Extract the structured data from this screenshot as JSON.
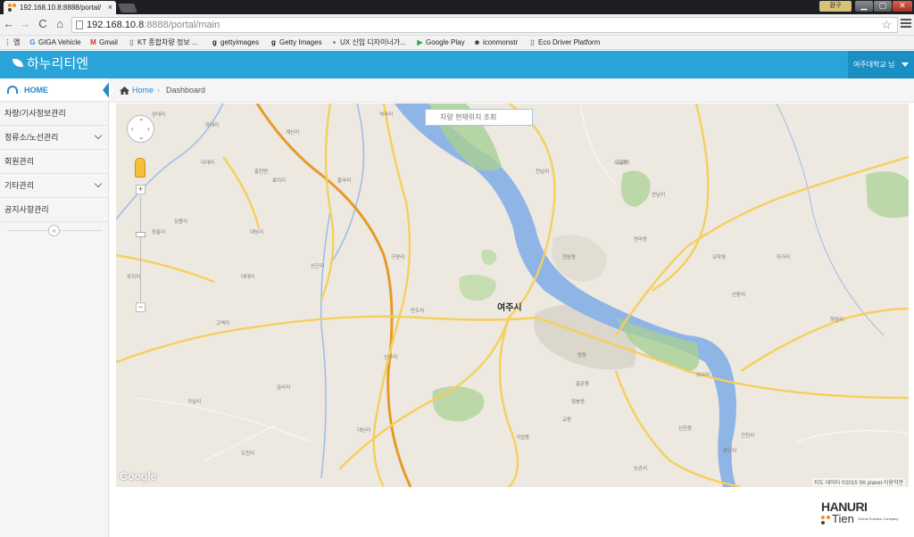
{
  "browser": {
    "tab_title": "192.168.10.8:8888/portal/",
    "close_glyph": "×",
    "url_host": "192.168.10.8",
    "url_path": ":8888/portal/main",
    "user_badge": "환구",
    "win_min": "▁",
    "win_max": "▢",
    "win_close": "✕",
    "nav": {
      "back": "←",
      "forward": "→",
      "reload": "C",
      "home": "⌂"
    },
    "star": "☆",
    "bookmarks": [
      {
        "label": "앱",
        "icon": "apps-icon",
        "glyph": "⋮"
      },
      {
        "label": "GIGA Vehicle",
        "icon": "google-icon",
        "glyph": "G"
      },
      {
        "label": "Gmail",
        "icon": "gmail-icon",
        "glyph": "M"
      },
      {
        "label": "KT 종합차량 정보 ...",
        "icon": "page-icon",
        "glyph": "▯"
      },
      {
        "label": "gettyimages",
        "icon": "getty-icon",
        "glyph": "g"
      },
      {
        "label": "Getty Images",
        "icon": "getty-icon",
        "glyph": "g"
      },
      {
        "label": "UX 신입 디자이너가...",
        "icon": "ux-icon",
        "glyph": "▪"
      },
      {
        "label": "Google Play",
        "icon": "play-icon",
        "glyph": "▶"
      },
      {
        "label": "iconmonstr",
        "icon": "iconmonstr-icon",
        "glyph": "☻"
      },
      {
        "label": "Eco Driver Platform",
        "icon": "page-icon",
        "glyph": "▯"
      }
    ]
  },
  "app": {
    "logo": "하누리티엔",
    "user_menu": "여주대학교 님",
    "colors": {
      "header": "#2aa3d8",
      "accent": "#2a86c7"
    }
  },
  "sidebar": {
    "home": "HOME",
    "items": [
      {
        "label": "차량/기사정보관리",
        "has_sub": false
      },
      {
        "label": "정류소/노선관리",
        "has_sub": true
      },
      {
        "label": "회원관리",
        "has_sub": false
      },
      {
        "label": "기타관리",
        "has_sub": true
      },
      {
        "label": "공지사항관리",
        "has_sub": false
      }
    ],
    "collapse": "«"
  },
  "breadcrumb": {
    "home": "Home",
    "sep": "›",
    "current": "Dashboard"
  },
  "map": {
    "search_placeholder": "차량 현재위치 조회",
    "city": "여주시",
    "google": "Google",
    "attribution": "지도 데이터 ©2015 SK planet   이용약관",
    "zoom_in": "+",
    "zoom_out": "−",
    "pan": {
      "up": "⌃",
      "down": "⌄",
      "left": "‹",
      "right": "›"
    },
    "places": [
      "상대리",
      "하대리",
      "흥천면",
      "다대리",
      "계신리",
      "효지리",
      "울국리",
      "대당리",
      "상용리",
      "대대리",
      "무지리",
      "장흥리",
      "고백리",
      "신근리",
      "구양리",
      "석곡리",
      "반도리",
      "신가리",
      "고교리",
      "금사리",
      "건천리",
      "외사리",
      "옹단리",
      "산남리",
      "현암동",
      "연라동",
      "오학동",
      "오금동",
      "하거리",
      "가업동",
      "능촌리",
      "천남리",
      "신진동",
      "점봉동",
      "홍문동",
      "교동",
      "창동",
      "가남리",
      "도천리",
      "대신리",
      "선동리",
      "하림리"
    ]
  },
  "footer": {
    "brand1": "HANURI",
    "brand2": "Tien",
    "tagline": "Global Solution Company"
  }
}
